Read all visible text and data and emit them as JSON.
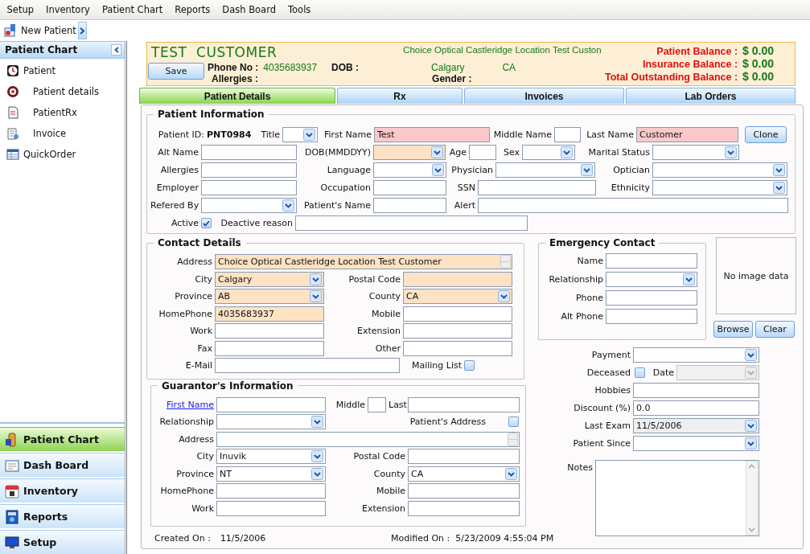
{
  "menu": [
    "Setup",
    "Inventory",
    "Patient Chart",
    "Reports",
    "Dash Board",
    "Tools"
  ],
  "toolbar": {
    "button": "New Patient"
  },
  "sidebar": {
    "title": "Patient Chart",
    "tree": [
      {
        "label": "Patient",
        "children": [
          {
            "label": "Patient details"
          },
          {
            "label": "PatientRx"
          },
          {
            "label": "Invoice"
          }
        ]
      },
      {
        "label": "QuickOrder"
      }
    ],
    "nav": [
      {
        "label": "Patient Chart",
        "selected": true
      },
      {
        "label": "Dash Board",
        "selected": false
      },
      {
        "label": "Inventory",
        "selected": false
      },
      {
        "label": "Reports",
        "selected": false
      },
      {
        "label": "Setup",
        "selected": false
      }
    ]
  },
  "header": {
    "name": "TEST  CUSTOMER",
    "save": "Save",
    "phone_label": "Phone No :",
    "phone": "4035683937",
    "dob_label": "DOB :",
    "allergies_label": "Allergies :",
    "address": "Choice Optical Castleridge Location Test Custon",
    "city": "Calgary",
    "country": "CA",
    "gender_label": "Gender :",
    "balances": [
      {
        "label": "Patient Balance :",
        "value": "$ 0.00"
      },
      {
        "label": "Insurance Balance :",
        "value": "$ 0.00"
      },
      {
        "label": "Total Outstanding Balance :",
        "value": "$ 0.00"
      }
    ]
  },
  "tabs": [
    {
      "label": "Patient Details",
      "selected": true
    },
    {
      "label": "Rx",
      "selected": false
    },
    {
      "label": "Invoices",
      "selected": false
    },
    {
      "label": "Lab Orders",
      "selected": false
    }
  ],
  "patient_info": {
    "title": "Patient Information",
    "lines": [
      {
        "fields": [
          {
            "label": "Patient ID:",
            "kind": "value",
            "value": "PNT0984"
          },
          {
            "label": "Title",
            "kind": "select"
          },
          {
            "label": "First Name",
            "kind": "text",
            "value": "Test",
            "required": true
          },
          {
            "label": "Middle Name",
            "kind": "text"
          },
          {
            "label": "Last Name",
            "kind": "text",
            "value": "Customer",
            "required": true
          },
          {
            "kind": "button",
            "text": "Clone"
          }
        ]
      },
      {
        "fields": [
          {
            "label": "Alt Name",
            "kind": "text"
          },
          {
            "label": "DOB(MMDDYY)",
            "kind": "select",
            "highlighted": true
          },
          {
            "label": "Age",
            "kind": "text"
          },
          {
            "label": "Sex",
            "kind": "select"
          },
          {
            "label": "Marital Status",
            "kind": "select"
          }
        ]
      },
      {
        "fields": [
          {
            "label": "Allergies",
            "kind": "text"
          },
          {
            "label": "Language",
            "kind": "select"
          },
          {
            "label": "Physician",
            "kind": "select"
          },
          {
            "label": "Optician",
            "kind": "select"
          }
        ]
      },
      {
        "fields": [
          {
            "label": "Employer",
            "kind": "text"
          },
          {
            "label": "Occupation",
            "kind": "text"
          },
          {
            "label": "SSN",
            "kind": "text"
          },
          {
            "label": "Ethnicity",
            "kind": "select"
          }
        ]
      },
      {
        "fields": [
          {
            "label": "Refered By",
            "kind": "select"
          },
          {
            "label": "Patient's Name",
            "kind": "text"
          },
          {
            "label": "Alert",
            "kind": "text"
          }
        ]
      },
      {
        "fields": [
          {
            "label": "Active",
            "kind": "check",
            "checked": true
          },
          {
            "label": "Deactive reason",
            "kind": "text"
          }
        ]
      }
    ]
  },
  "contact": {
    "title": "Contact Details",
    "lines": [
      {
        "fields": [
          {
            "label": "Address",
            "kind": "memo",
            "value": "Choice Optical Castleridge Location Test Customer",
            "highlighted": true
          }
        ]
      },
      {
        "fields": [
          {
            "label": "City",
            "kind": "select",
            "value": "Calgary",
            "highlighted": true
          },
          {
            "label": "Postal Code",
            "kind": "text",
            "highlighted": true
          }
        ]
      },
      {
        "fields": [
          {
            "label": "Province",
            "kind": "select",
            "value": "AB",
            "highlighted": true
          },
          {
            "label": "County",
            "kind": "select",
            "value": "CA",
            "highlighted": true
          }
        ]
      },
      {
        "fields": [
          {
            "label": "HomePhone",
            "kind": "text",
            "value": "4035683937",
            "highlighted": true
          },
          {
            "label": "Mobile",
            "kind": "text"
          }
        ]
      },
      {
        "fields": [
          {
            "label": "Work",
            "kind": "text"
          },
          {
            "label": "Extension",
            "kind": "text"
          }
        ]
      },
      {
        "fields": [
          {
            "label": "Fax",
            "kind": "text"
          },
          {
            "label": "Other",
            "kind": "text"
          }
        ]
      },
      {
        "fields": [
          {
            "label": "E-Mail",
            "kind": "text"
          },
          {
            "label": "Mailing List",
            "kind": "check",
            "checked": false
          }
        ]
      }
    ]
  },
  "guarantor": {
    "title": "Guarantor's Information",
    "lines": [
      {
        "fields": [
          {
            "label": "First Name",
            "link": true,
            "kind": "text"
          },
          {
            "label": "Middle",
            "kind": "text"
          },
          {
            "label": "Last",
            "kind": "text"
          }
        ]
      },
      {
        "fields": [
          {
            "label": "Relationship",
            "kind": "select"
          },
          {
            "label": "Patient's Address",
            "kind": "check",
            "checked": false
          }
        ]
      },
      {
        "fields": [
          {
            "label": "Address",
            "kind": "memo"
          }
        ]
      },
      {
        "fields": [
          {
            "label": "City",
            "kind": "select",
            "value": "Inuvik"
          },
          {
            "label": "Postal Code",
            "kind": "text"
          }
        ]
      },
      {
        "fields": [
          {
            "label": "Province",
            "kind": "select",
            "value": "NT"
          },
          {
            "label": "County",
            "kind": "select",
            "value": "CA"
          }
        ]
      },
      {
        "fields": [
          {
            "label": "HomePhone",
            "kind": "text"
          },
          {
            "label": "Mobile",
            "kind": "text"
          }
        ]
      },
      {
        "fields": [
          {
            "label": "Work",
            "kind": "text"
          },
          {
            "label": "Extension",
            "kind": "text"
          }
        ]
      }
    ]
  },
  "emergency": {
    "title": "Emergency Contact",
    "lines": [
      {
        "fields": [
          {
            "label": "Name",
            "kind": "text"
          }
        ]
      },
      {
        "fields": [
          {
            "label": "Relationship",
            "kind": "select"
          }
        ]
      },
      {
        "fields": [
          {
            "label": "Phone",
            "kind": "text"
          }
        ]
      },
      {
        "fields": [
          {
            "label": "Alt Phone",
            "kind": "text"
          }
        ]
      }
    ]
  },
  "photo": {
    "text": "No image data",
    "buttons": [
      "Browse",
      "Clear"
    ]
  },
  "extra": {
    "lines": [
      {
        "fields": [
          {
            "label": "Payment",
            "kind": "select"
          }
        ]
      },
      {
        "fields": [
          {
            "label": "Deceased",
            "kind": "check",
            "checked": false
          },
          {
            "label": "Date",
            "kind": "select",
            "disabled": true
          }
        ]
      },
      {
        "fields": [
          {
            "label": "Hobbies",
            "kind": "text"
          }
        ]
      },
      {
        "fields": [
          {
            "label": "Discount (%)",
            "kind": "text",
            "value": "0.0"
          }
        ]
      },
      {
        "fields": [
          {
            "label": "Last Exam",
            "kind": "select",
            "value": "11/5/2006",
            "readonly": true
          }
        ]
      },
      {
        "fields": [
          {
            "label": "Patient Since",
            "kind": "select"
          }
        ]
      }
    ]
  },
  "notes": {
    "label": "Notes"
  },
  "footer": {
    "created_label": "Created On :",
    "created": "11/5/2006",
    "modified_label": "Modified On :",
    "modified": "5/23/2009 4:55:04 PM"
  }
}
